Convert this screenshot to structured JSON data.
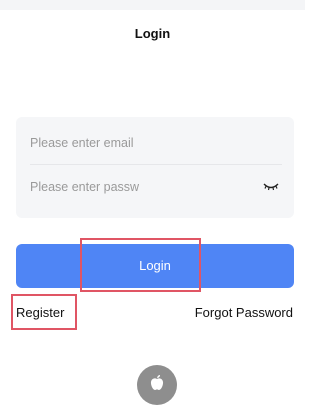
{
  "header": {
    "title": "Login"
  },
  "form": {
    "email_placeholder": "Please enter email",
    "password_placeholder": "Please enter passw",
    "password_toggle_icon": "eye-closed-icon"
  },
  "actions": {
    "login_label": "Login",
    "register_label": "Register",
    "forgot_label": "Forgot Password"
  },
  "social": {
    "apple_icon": "apple-icon"
  },
  "colors": {
    "primary": "#4f85f5",
    "highlight": "#e05564",
    "input_bg": "#f5f6f8",
    "apple_bg": "#8e8e8e"
  }
}
